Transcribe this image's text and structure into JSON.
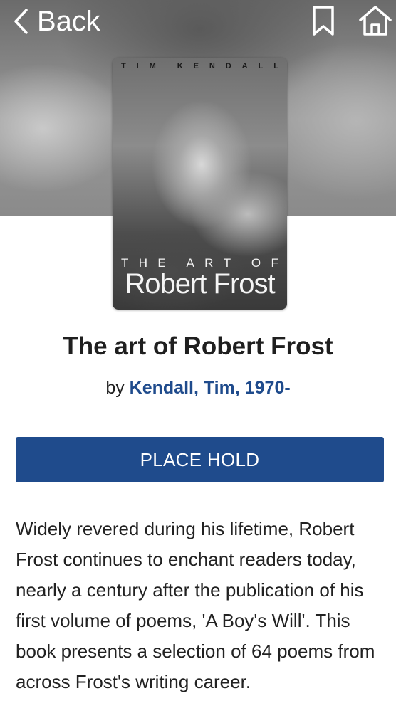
{
  "nav": {
    "back_label": "Back"
  },
  "cover": {
    "author_letters": [
      "T",
      "I",
      "M",
      "",
      "K",
      "E",
      "N",
      "D",
      "A",
      "L",
      "L"
    ],
    "subtitle_words": [
      "T",
      "H",
      "E",
      "",
      "A",
      "R",
      "T",
      "",
      "O",
      "F"
    ],
    "title_text": "Robert Frost"
  },
  "book": {
    "title": "The art of Robert Frost",
    "by_label": "by",
    "author": "Kendall, Tim, 1970-"
  },
  "actions": {
    "place_hold": "PLACE HOLD"
  },
  "description": "Widely revered during his lifetime, Robert Frost continues to enchant readers today, nearly a century after the publication of his first volume of poems, 'A Boy's Will'. This book presents a selection of 64 poems from across Frost's writing career.",
  "colors": {
    "accent": "#1f4b8c",
    "text": "#222222",
    "header_icon": "#ffffff"
  },
  "icons": [
    "chevron-left-icon",
    "bookmark-icon",
    "home-icon"
  ]
}
